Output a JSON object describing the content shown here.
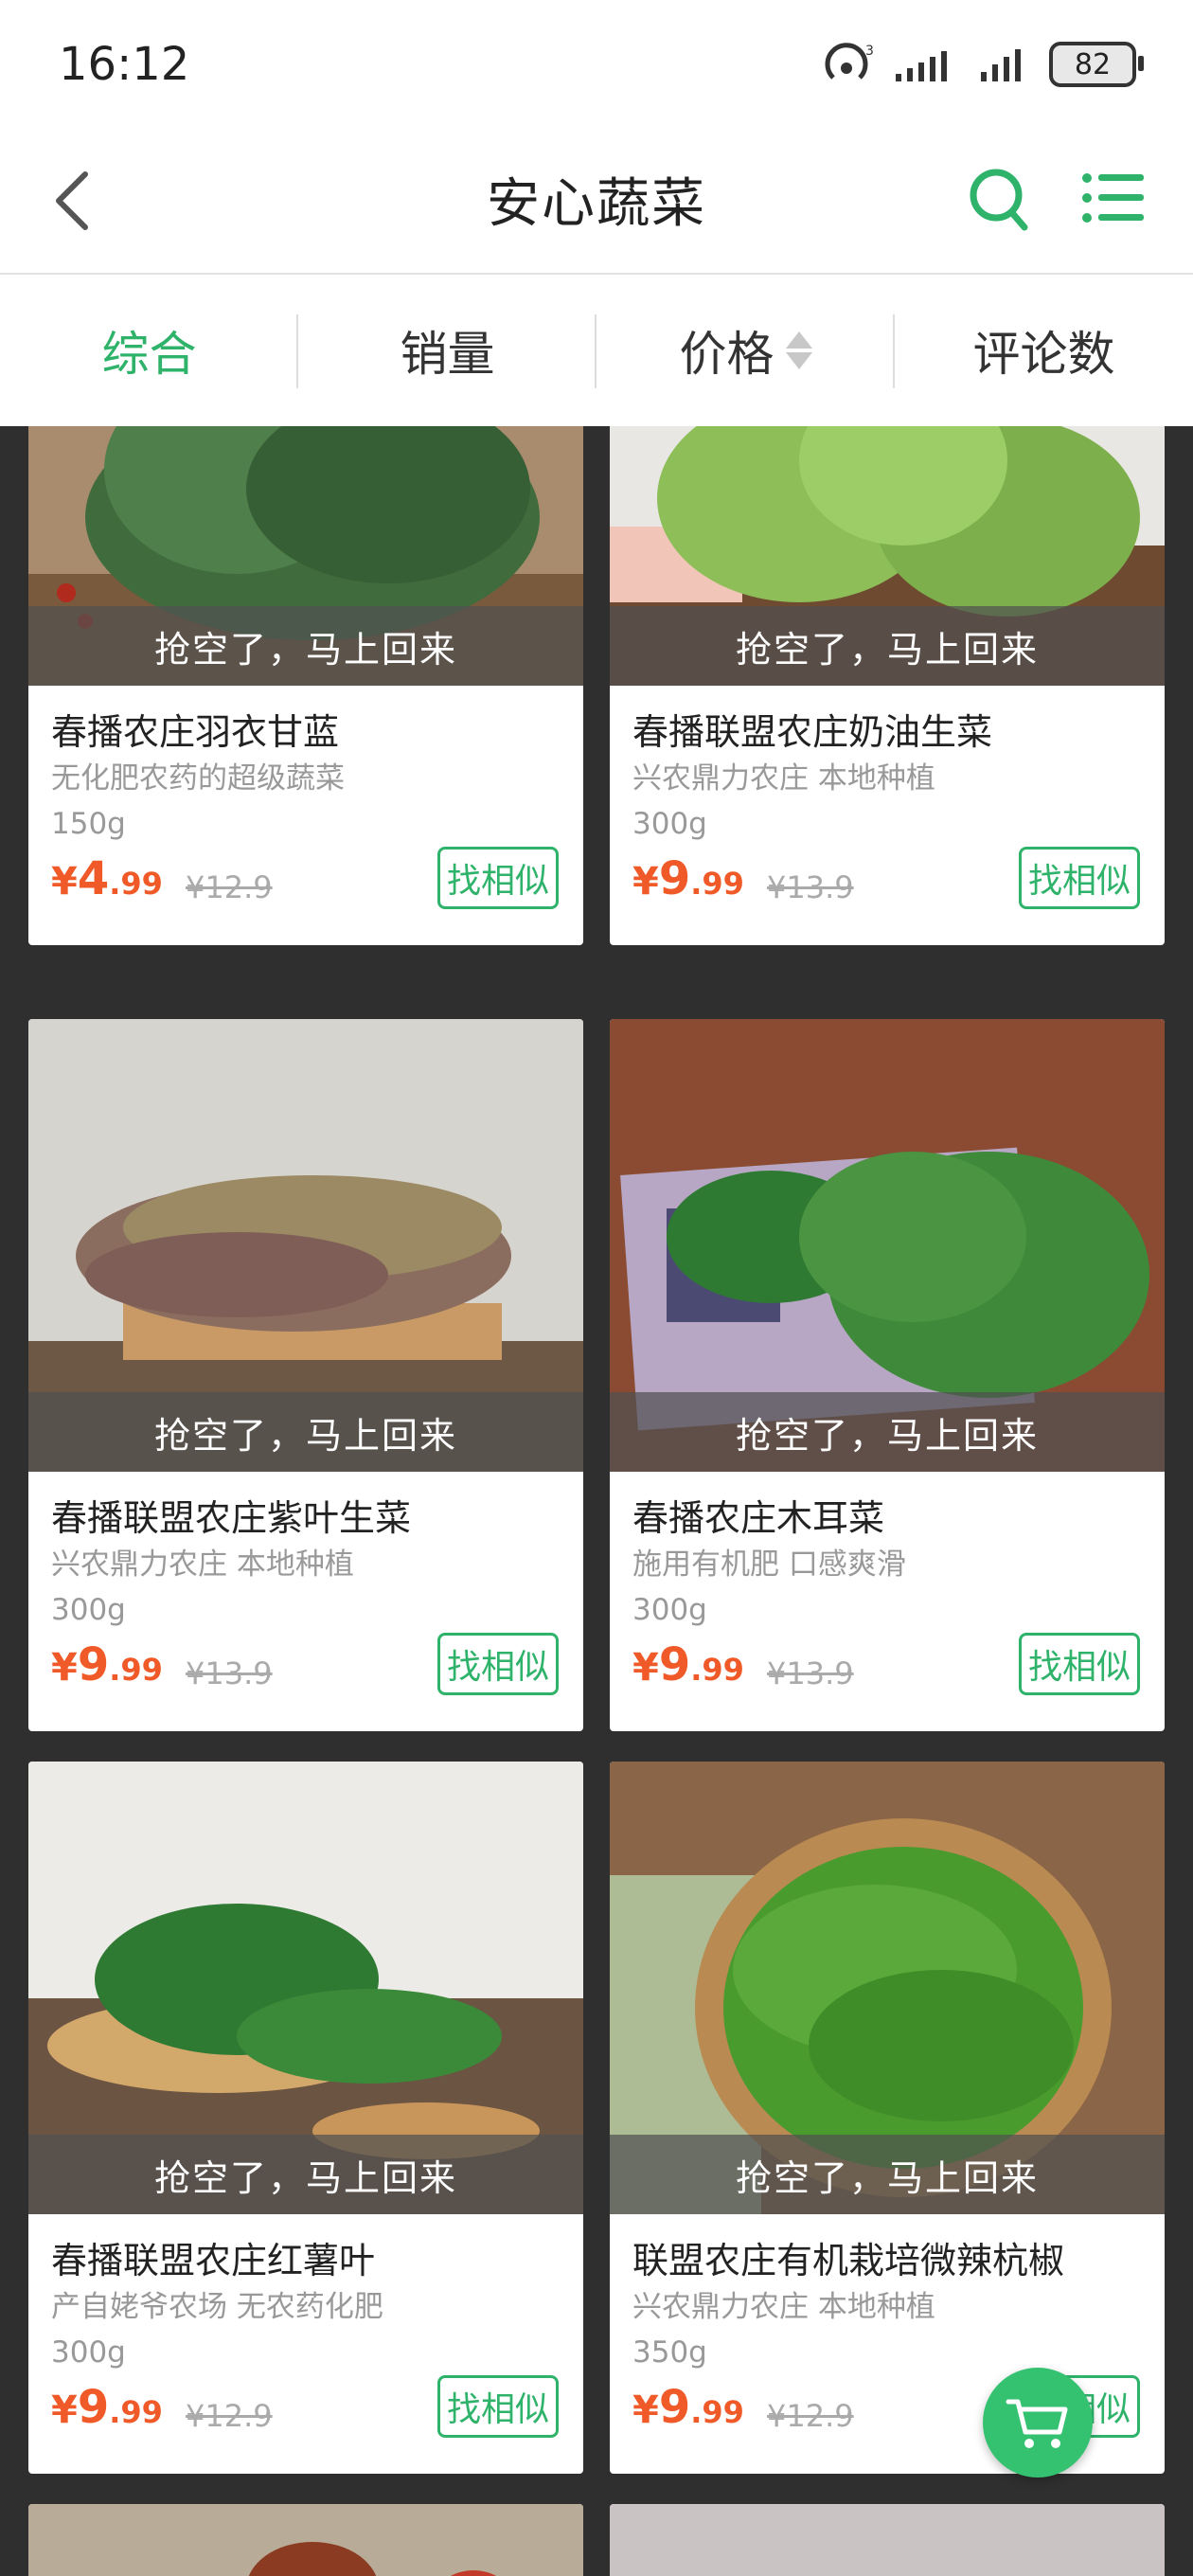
{
  "status_bar": {
    "time": "16:12",
    "battery": "82"
  },
  "nav": {
    "title": "安心蔬菜"
  },
  "sort_tabs": [
    {
      "label": "综合",
      "active": true
    },
    {
      "label": "销量",
      "active": false
    },
    {
      "label": "价格",
      "active": false
    },
    {
      "label": "评论数",
      "active": false
    }
  ],
  "products": [
    {
      "banner": "抢空了，马上回来",
      "name": "春播农庄羽衣甘蓝",
      "desc": "无化肥农药的超级蔬菜",
      "weight": "150g",
      "price_yen": "¥",
      "price_int": "4",
      "price_dec": ".99",
      "orig_price": "¥12.9",
      "similar": "找相似"
    },
    {
      "banner": "抢空了，马上回来",
      "name": "春播联盟农庄奶油生菜",
      "desc": "兴农鼎力农庄 本地种植",
      "weight": "300g",
      "price_yen": "¥",
      "price_int": "9",
      "price_dec": ".99",
      "orig_price": "¥13.9",
      "similar": "找相似"
    },
    {
      "banner": "抢空了，马上回来",
      "name": "春播联盟农庄紫叶生菜",
      "desc": "兴农鼎力农庄 本地种植",
      "weight": "300g",
      "price_yen": "¥",
      "price_int": "9",
      "price_dec": ".99",
      "orig_price": "¥13.9",
      "similar": "找相似"
    },
    {
      "banner": "抢空了，马上回来",
      "name": "春播农庄木耳菜",
      "desc": "施用有机肥 口感爽滑",
      "weight": "300g",
      "price_yen": "¥",
      "price_int": "9",
      "price_dec": ".99",
      "orig_price": "¥13.9",
      "similar": "找相似"
    },
    {
      "banner": "抢空了，马上回来",
      "name": "春播联盟农庄红薯叶",
      "desc": "产自姥爷农场 无农药化肥",
      "weight": "300g",
      "price_yen": "¥",
      "price_int": "9",
      "price_dec": ".99",
      "orig_price": "¥12.9",
      "similar": "找相似"
    },
    {
      "banner": "抢空了，马上回来",
      "name": "联盟农庄有机栽培微辣杭椒",
      "desc": "兴农鼎力农庄 本地种植",
      "weight": "350g",
      "price_yen": "¥",
      "price_int": "9",
      "price_dec": ".99",
      "orig_price": "¥12.9",
      "similar": "找相似"
    }
  ],
  "icons": {
    "back": "chevron-left-icon",
    "search": "search-icon",
    "menu": "list-icon",
    "cart": "cart-icon",
    "sort": "sort-arrows-icon"
  },
  "colors": {
    "accent": "#2fb36b",
    "price": "#f05a28",
    "background": "#2f2f2f"
  }
}
